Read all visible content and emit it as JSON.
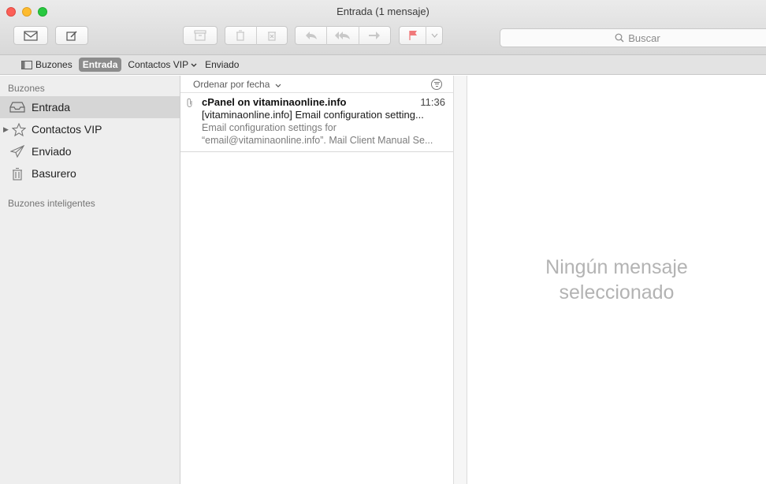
{
  "window": {
    "title": "Entrada (1 mensaje)"
  },
  "toolbar": {
    "buttons": [
      {
        "name": "get-mail",
        "icon": "envelope-icon",
        "enabled": true
      },
      {
        "name": "compose",
        "icon": "compose-icon",
        "enabled": true
      },
      {
        "name": "archive",
        "icon": "archive-icon",
        "enabled": false
      },
      {
        "name": "delete",
        "icon": "trash-icon",
        "enabled": false
      },
      {
        "name": "junk",
        "icon": "junk-icon",
        "enabled": false
      },
      {
        "name": "reply",
        "icon": "reply-icon",
        "enabled": false
      },
      {
        "name": "reply-all",
        "icon": "reply-all-icon",
        "enabled": false
      },
      {
        "name": "forward",
        "icon": "forward-icon",
        "enabled": false
      },
      {
        "name": "flag",
        "icon": "flag-icon",
        "enabled": false
      },
      {
        "name": "flag-menu",
        "icon": "chevron-down-icon",
        "enabled": false
      }
    ],
    "flag_color": "#f0797a"
  },
  "search": {
    "placeholder": "Buscar"
  },
  "favorites": {
    "mailboxes_label": "Buzones",
    "items": [
      {
        "label": "Entrada",
        "selected": true
      },
      {
        "label": "Contactos VIP",
        "has_menu": true
      },
      {
        "label": "Enviado"
      }
    ]
  },
  "sidebar": {
    "section_mailboxes": "Buzones",
    "items": [
      {
        "label": "Entrada",
        "icon": "inbox-tray-icon",
        "selected": true
      },
      {
        "label": "Contactos VIP",
        "icon": "star-icon",
        "expandable": true
      },
      {
        "label": "Enviado",
        "icon": "paper-plane-icon"
      },
      {
        "label": "Basurero",
        "icon": "trash-icon"
      }
    ],
    "section_smart": "Buzones inteligentes"
  },
  "message_list": {
    "sort_label": "Ordenar por fecha",
    "messages": [
      {
        "sender": "cPanel on vitaminaonline.info",
        "time": "11:36",
        "subject": "[vitaminaonline.info] Email configuration setting...",
        "preview_line1": "Email configuration settings for",
        "preview_line2": "“email@vitaminaonline.info”. Mail Client Manual Se...",
        "has_attachment": true
      }
    ]
  },
  "viewer": {
    "empty_line1": "Ningún mensaje",
    "empty_line2": "seleccionado"
  }
}
